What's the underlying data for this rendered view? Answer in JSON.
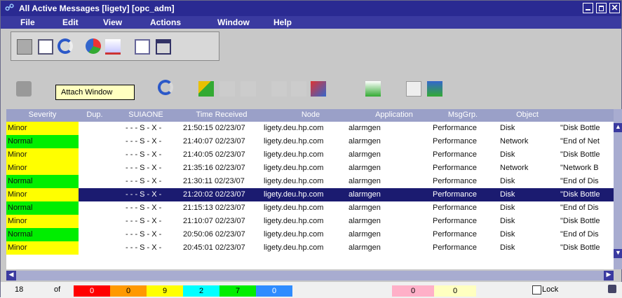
{
  "window": {
    "title": "All Active Messages [ligety] [opc_adm]"
  },
  "menu": [
    "File",
    "Edit",
    "View",
    "Actions",
    "Window",
    "Help"
  ],
  "tooltip": "Attach Window",
  "columns": [
    "Severity",
    "Dup.",
    "SUIAONE",
    "Time Received",
    "Node",
    "Application",
    "MsgGrp.",
    "Object",
    ""
  ],
  "colors": {
    "minor": "#ffff00",
    "normal": "#00ee00",
    "selected": "#1b1b70",
    "titlebar": "#2a2a92"
  },
  "rows": [
    {
      "sev": "Minor",
      "flags": "- - - S - X -",
      "time": "21:50:15 02/23/07",
      "node": "ligety.deu.hp.com",
      "app": "alarmgen",
      "grp": "Performance",
      "obj": "Disk",
      "text": "\"Disk Bottle"
    },
    {
      "sev": "Normal",
      "flags": "- - - S - X -",
      "time": "21:40:07 02/23/07",
      "node": "ligety.deu.hp.com",
      "app": "alarmgen",
      "grp": "Performance",
      "obj": "Network",
      "text": "\"End of Net"
    },
    {
      "sev": "Minor",
      "flags": "- - - S - X -",
      "time": "21:40:05 02/23/07",
      "node": "ligety.deu.hp.com",
      "app": "alarmgen",
      "grp": "Performance",
      "obj": "Disk",
      "text": "\"Disk Bottle"
    },
    {
      "sev": "Minor",
      "flags": "- - - S - X -",
      "time": "21:35:16 02/23/07",
      "node": "ligety.deu.hp.com",
      "app": "alarmgen",
      "grp": "Performance",
      "obj": "Network",
      "text": "\"Network B"
    },
    {
      "sev": "Normal",
      "flags": "- - - S - X -",
      "time": "21:30:11 02/23/07",
      "node": "ligety.deu.hp.com",
      "app": "alarmgen",
      "grp": "Performance",
      "obj": "Disk",
      "text": "\"End of Dis"
    },
    {
      "sev": "Minor",
      "flags": "- - - S - X -",
      "time": "21:20:02 02/23/07",
      "node": "ligety.deu.hp.com",
      "app": "alarmgen",
      "grp": "Performance",
      "obj": "Disk",
      "text": "\"Disk Bottle"
    },
    {
      "sev": "Normal",
      "flags": "- - - S - X -",
      "time": "21:15:13 02/23/07",
      "node": "ligety.deu.hp.com",
      "app": "alarmgen",
      "grp": "Performance",
      "obj": "Disk",
      "text": "\"End of Dis"
    },
    {
      "sev": "Minor",
      "flags": "- - - S - X -",
      "time": "21:10:07 02/23/07",
      "node": "ligety.deu.hp.com",
      "app": "alarmgen",
      "grp": "Performance",
      "obj": "Disk",
      "text": "\"Disk Bottle"
    },
    {
      "sev": "Normal",
      "flags": "- - - S - X -",
      "time": "20:50:06 02/23/07",
      "node": "ligety.deu.hp.com",
      "app": "alarmgen",
      "grp": "Performance",
      "obj": "Disk",
      "text": "\"End of Dis"
    },
    {
      "sev": "Minor",
      "flags": "- - - S - X -",
      "time": "20:45:01 02/23/07",
      "node": "ligety.deu.hp.com",
      "app": "alarmgen",
      "grp": "Performance",
      "obj": "Disk",
      "text": "\"Disk Bottle"
    }
  ],
  "selected_row": 5,
  "status": {
    "total": "18",
    "of_label": "of",
    "counters": [
      {
        "value": "0",
        "color": "#ff0000",
        "text_color": "#ffffff"
      },
      {
        "value": "0",
        "color": "#ff9900",
        "text_color": "#000000"
      },
      {
        "value": "9",
        "color": "#ffff00",
        "text_color": "#000000"
      },
      {
        "value": "2",
        "color": "#00ffff",
        "text_color": "#000000"
      },
      {
        "value": "7",
        "color": "#00ee00",
        "text_color": "#000000"
      },
      {
        "value": "0",
        "color": "#2f8cff",
        "text_color": "#ffffff"
      }
    ],
    "extra_counters": [
      {
        "value": "0",
        "color": "#ffb0c8"
      },
      {
        "value": "0",
        "color": "#ffffc0"
      }
    ],
    "lock_label": "Lock"
  }
}
